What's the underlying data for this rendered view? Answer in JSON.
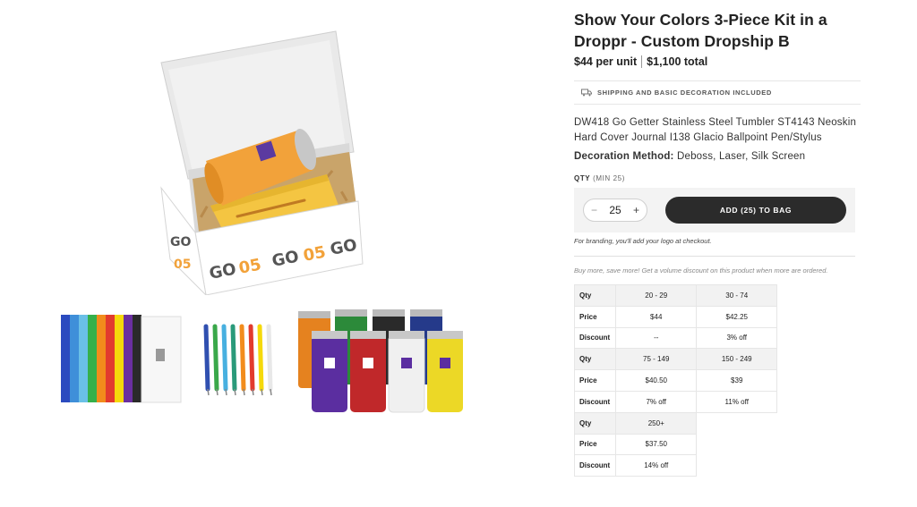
{
  "product": {
    "title": "Show Your Colors 3-Piece Kit in a Droppr - Custom Dropship B",
    "price_per_unit": "$44 per unit",
    "price_total": "$1,100 total",
    "shipping_note": "SHIPPING AND BASIC DECORATION INCLUDED",
    "description": "DW418 Go Getter Stainless Steel Tumbler ST4143 Neoskin Hard Cover Journal I138 Glacio Ballpoint Pen/Stylus",
    "decoration_label": "Decoration Method:",
    "decoration_value": "Deboss, Laser, Silk Screen"
  },
  "qty": {
    "label": "QTY",
    "min_note": "(MIN 25)",
    "value": "25",
    "minus": "−",
    "plus": "+",
    "add_button": "ADD (25) TO BAG",
    "branding_note": "For branding, you'll add your logo at checkout.",
    "volume_note": "Buy more, save more! Get a volume discount on this product when more are ordered."
  },
  "pricing_table": {
    "rows": [
      {
        "label": "Qty",
        "c1": "20 - 29",
        "c2": "30 - 74",
        "hdr": true
      },
      {
        "label": "Price",
        "c1": "$44",
        "c2": "$42.25"
      },
      {
        "label": "Discount",
        "c1": "--",
        "c2": "3% off"
      },
      {
        "label": "Qty",
        "c1": "75 - 149",
        "c2": "150 - 249",
        "hdr": true
      },
      {
        "label": "Price",
        "c1": "$40.50",
        "c2": "$39"
      },
      {
        "label": "Discount",
        "c1": "7% off",
        "c2": "11% off"
      },
      {
        "label": "Qty",
        "c1": "250+",
        "c2": "",
        "hdr": true
      },
      {
        "label": "Price",
        "c1": "$37.50",
        "c2": ""
      },
      {
        "label": "Discount",
        "c1": "14% off",
        "c2": ""
      }
    ]
  },
  "gallery": {
    "main_image": "kit-box-image",
    "thumbnails": [
      "journals-colors-thumb",
      "pens-colors-thumb",
      "tumblers-colors-thumb"
    ],
    "box_logo_text": "GO 05"
  },
  "colors": {
    "accent_dark": "#2b2b2b",
    "tumbler_orange": "#f2a23a",
    "journal_yellow": "#f4c542"
  }
}
